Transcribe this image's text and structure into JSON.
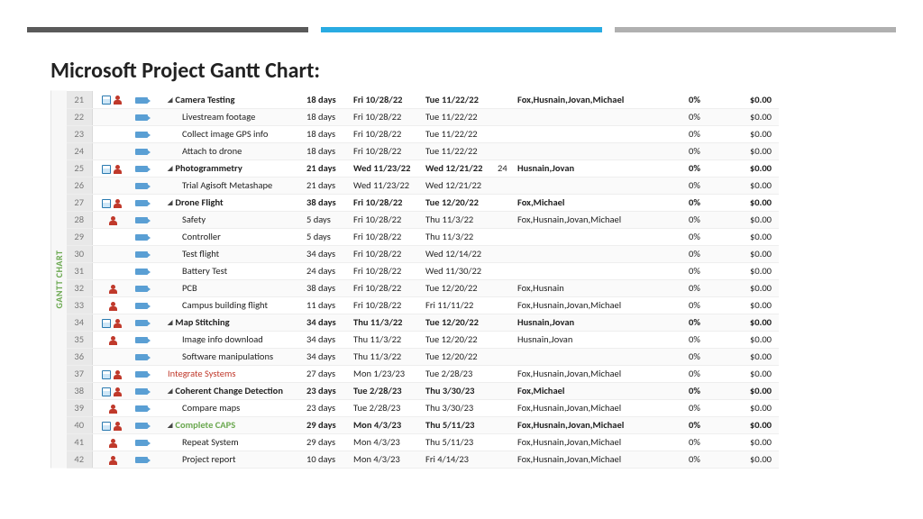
{
  "title": "Microsoft Project Gantt Chart:",
  "sideLabel": "GANTT CHART",
  "rows": [
    {
      "n": "21",
      "cal": true,
      "person": true,
      "task": true,
      "bold": true,
      "caret": true,
      "ind": 1,
      "name": "Camera Testing",
      "dur": "18 days",
      "start": "Fri 10/28/22",
      "finish": "Tue 11/22/22",
      "pred": "",
      "res": "Fox,Husnain,Jovan,Michael",
      "pct": "0%",
      "cost": "$0.00"
    },
    {
      "n": "22",
      "cal": false,
      "person": false,
      "task": true,
      "ind": 2,
      "name": "Livestream footage",
      "dur": "18 days",
      "start": "Fri 10/28/22",
      "finish": "Tue 11/22/22",
      "pred": "",
      "res": "",
      "pct": "0%",
      "cost": "$0.00"
    },
    {
      "n": "23",
      "cal": false,
      "person": false,
      "task": true,
      "ind": 2,
      "name": "Collect image GPS info",
      "dur": "18 days",
      "start": "Fri 10/28/22",
      "finish": "Tue 11/22/22",
      "pred": "",
      "res": "",
      "pct": "0%",
      "cost": "$0.00"
    },
    {
      "n": "24",
      "cal": false,
      "person": false,
      "task": true,
      "ind": 2,
      "name": "Attach to drone",
      "dur": "18 days",
      "start": "Fri 10/28/22",
      "finish": "Tue 11/22/22",
      "pred": "",
      "res": "",
      "pct": "0%",
      "cost": "$0.00"
    },
    {
      "n": "25",
      "cal": true,
      "person": true,
      "task": true,
      "bold": true,
      "caret": true,
      "ind": 1,
      "name": "Photogrammetry",
      "dur": "21 days",
      "start": "Wed 11/23/22",
      "finish": "Wed 12/21/22",
      "pred": "24",
      "res": "Husnain,Jovan",
      "pct": "0%",
      "cost": "$0.00"
    },
    {
      "n": "26",
      "cal": false,
      "person": false,
      "task": true,
      "ind": 2,
      "name": "Trial Agisoft Metashape",
      "dur": "21 days",
      "start": "Wed 11/23/22",
      "finish": "Wed 12/21/22",
      "pred": "",
      "res": "",
      "pct": "0%",
      "cost": "$0.00"
    },
    {
      "n": "27",
      "cal": true,
      "person": true,
      "task": true,
      "bold": true,
      "caret": true,
      "ind": 1,
      "name": "Drone Flight",
      "dur": "38 days",
      "start": "Fri 10/28/22",
      "finish": "Tue 12/20/22",
      "pred": "",
      "res": "Fox,Michael",
      "pct": "0%",
      "cost": "$0.00"
    },
    {
      "n": "28",
      "cal": false,
      "person": true,
      "task": true,
      "ind": 2,
      "name": "Safety",
      "dur": "5 days",
      "start": "Fri 10/28/22",
      "finish": "Thu 11/3/22",
      "pred": "",
      "res": "Fox,Husnain,Jovan,Michael",
      "pct": "0%",
      "cost": "$0.00"
    },
    {
      "n": "29",
      "cal": false,
      "person": false,
      "task": true,
      "ind": 2,
      "name": "Controller",
      "dur": "5 days",
      "start": "Fri 10/28/22",
      "finish": "Thu 11/3/22",
      "pred": "",
      "res": "",
      "pct": "0%",
      "cost": "$0.00"
    },
    {
      "n": "30",
      "cal": false,
      "person": false,
      "task": true,
      "ind": 2,
      "name": "Test flight",
      "dur": "34 days",
      "start": "Fri 10/28/22",
      "finish": "Wed 12/14/22",
      "pred": "",
      "res": "",
      "pct": "0%",
      "cost": "$0.00"
    },
    {
      "n": "31",
      "cal": false,
      "person": false,
      "task": true,
      "ind": 2,
      "name": "Battery Test",
      "dur": "24 days",
      "start": "Fri 10/28/22",
      "finish": "Wed 11/30/22",
      "pred": "",
      "res": "",
      "pct": "0%",
      "cost": "$0.00"
    },
    {
      "n": "32",
      "cal": false,
      "person": true,
      "task": true,
      "ind": 2,
      "name": "PCB",
      "dur": "38 days",
      "start": "Fri 10/28/22",
      "finish": "Tue 12/20/22",
      "pred": "",
      "res": "Fox,Husnain",
      "pct": "0%",
      "cost": "$0.00"
    },
    {
      "n": "33",
      "cal": false,
      "person": true,
      "task": true,
      "ind": 2,
      "name": "Campus building flight",
      "dur": "11 days",
      "start": "Fri 10/28/22",
      "finish": "Fri 11/11/22",
      "pred": "",
      "res": "Fox,Husnain,Jovan,Michael",
      "pct": "0%",
      "cost": "$0.00"
    },
    {
      "n": "34",
      "cal": true,
      "person": true,
      "task": true,
      "bold": true,
      "caret": true,
      "ind": 1,
      "name": "Map Stitching",
      "dur": "34 days",
      "start": "Thu 11/3/22",
      "finish": "Tue 12/20/22",
      "pred": "",
      "res": "Husnain,Jovan",
      "pct": "0%",
      "cost": "$0.00"
    },
    {
      "n": "35",
      "cal": false,
      "person": true,
      "task": true,
      "ind": 2,
      "name": "Image info download",
      "dur": "34 days",
      "start": "Thu 11/3/22",
      "finish": "Tue 12/20/22",
      "pred": "",
      "res": "Husnain,Jovan",
      "pct": "0%",
      "cost": "$0.00"
    },
    {
      "n": "36",
      "cal": false,
      "person": false,
      "task": true,
      "ind": 2,
      "name": "Software manipulations",
      "dur": "34 days",
      "start": "Thu 11/3/22",
      "finish": "Tue 12/20/22",
      "pred": "",
      "res": "",
      "pct": "0%",
      "cost": "$0.00"
    },
    {
      "n": "37",
      "cal": true,
      "person": true,
      "task": true,
      "ind": 1,
      "name": "Integrate Systems",
      "color": "red",
      "dur": "27 days",
      "start": "Mon 1/23/23",
      "finish": "Tue 2/28/23",
      "pred": "",
      "res": "Fox,Husnain,Jovan,Michael",
      "pct": "0%",
      "cost": "$0.00"
    },
    {
      "n": "38",
      "cal": true,
      "person": true,
      "task": true,
      "bold": true,
      "caret": true,
      "ind": 1,
      "name": "Coherent Change Detection",
      "dur": "23 days",
      "start": "Tue 2/28/23",
      "finish": "Thu 3/30/23",
      "pred": "",
      "res": "Fox,Michael",
      "pct": "0%",
      "cost": "$0.00"
    },
    {
      "n": "39",
      "cal": false,
      "person": true,
      "task": true,
      "ind": 2,
      "name": "Compare maps",
      "dur": "23 days",
      "start": "Tue 2/28/23",
      "finish": "Thu 3/30/23",
      "pred": "",
      "res": "Fox,Husnain,Jovan,Michael",
      "pct": "0%",
      "cost": "$0.00"
    },
    {
      "n": "40",
      "cal": true,
      "person": true,
      "task": true,
      "bold": true,
      "caret": true,
      "ind": 1,
      "name": "Complete CAPS",
      "color": "green",
      "dur": "29 days",
      "start": "Mon 4/3/23",
      "finish": "Thu 5/11/23",
      "pred": "",
      "res": "Fox,Husnain,Jovan,Michael",
      "pct": "0%",
      "cost": "$0.00"
    },
    {
      "n": "41",
      "cal": false,
      "person": true,
      "task": true,
      "ind": 2,
      "name": "Repeat System",
      "dur": "29 days",
      "start": "Mon 4/3/23",
      "finish": "Thu 5/11/23",
      "pred": "",
      "res": "Fox,Husnain,Jovan,Michael",
      "pct": "0%",
      "cost": "$0.00"
    },
    {
      "n": "42",
      "cal": false,
      "person": true,
      "task": true,
      "ind": 2,
      "name": "Project report",
      "dur": "10 days",
      "start": "Mon 4/3/23",
      "finish": "Fri 4/14/23",
      "pred": "",
      "res": "Fox,Husnain,Jovan,Michael",
      "pct": "0%",
      "cost": "$0.00"
    }
  ]
}
